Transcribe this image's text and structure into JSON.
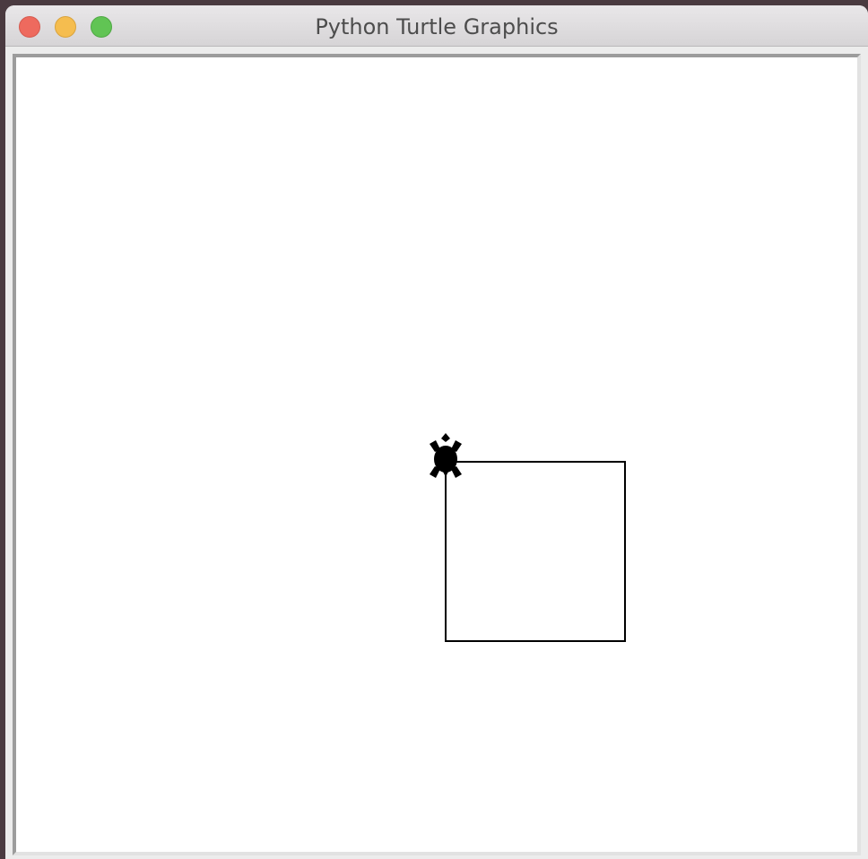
{
  "window": {
    "title": "Python Turtle Graphics"
  },
  "colors": {
    "canvas_background": "#ffffff",
    "pen": "#000000",
    "turtle": "#000000"
  },
  "icons": {
    "close": "close-traffic-light-icon",
    "minimize": "minimize-traffic-light-icon",
    "zoom": "zoom-traffic-light-icon",
    "turtle": "turtle-cursor-icon"
  }
}
